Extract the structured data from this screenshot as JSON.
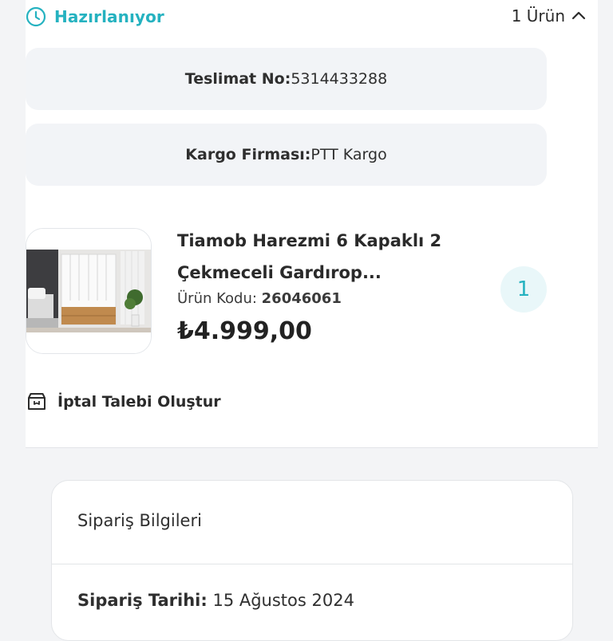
{
  "header": {
    "status": "Hazırlanıyor",
    "status_icon": "clock-icon",
    "count": "1 Ürün",
    "toggle_icon": "chevron-up-icon",
    "accent_color": "#25b2c0"
  },
  "delivery": {
    "tracking_label": "Teslimat No:",
    "tracking_value": "5314433288",
    "carrier_label": "Kargo Firması:",
    "carrier_value": "PTT Kargo"
  },
  "product": {
    "title": "Tiamob Harezmi 6 Kapaklı 2 Çekmeceli Gardırop...",
    "code_label": "Ürün Kodu: ",
    "code_value": "26046061",
    "price": "₺4.999,00",
    "quantity": "1",
    "image_icon": "wardrobe-product-image"
  },
  "actions": {
    "cancel_label": "İptal Talebi Oluştur",
    "cancel_icon": "package-icon"
  },
  "order_info": {
    "title": "Sipariş Bilgileri",
    "date_label": "Sipariş Tarihi:",
    "date_value": " 15 Ağustos 2024"
  }
}
